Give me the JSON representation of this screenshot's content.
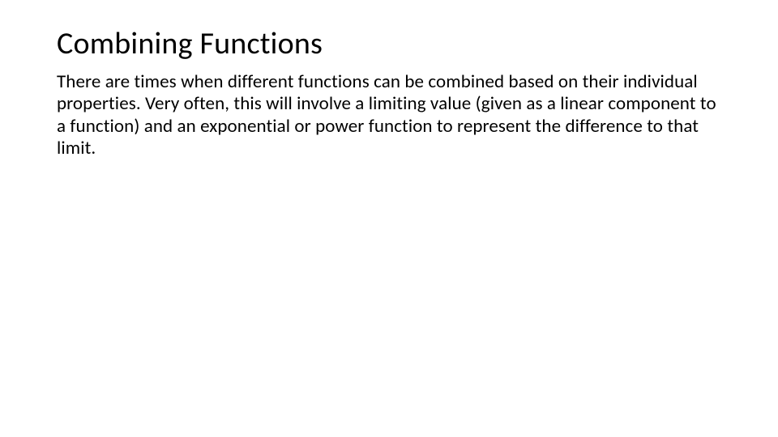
{
  "slide": {
    "title": "Combining Functions",
    "body": "There are times when different functions can be combined based on their individual properties.  Very often, this will involve a limiting value (given as a linear component to a function) and an exponential or power function to represent the difference to that limit."
  }
}
